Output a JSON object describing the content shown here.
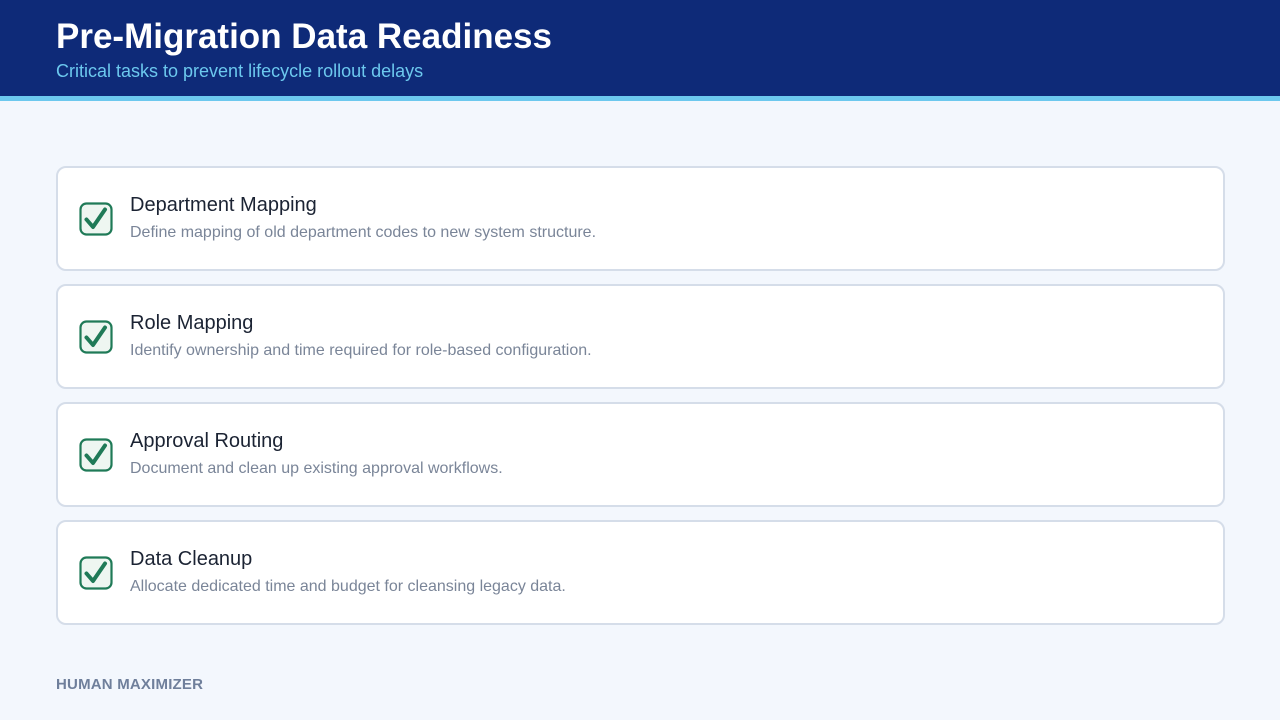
{
  "header": {
    "title": "Pre-Migration Data Readiness",
    "subtitle": "Critical tasks to prevent lifecycle rollout delays"
  },
  "colors": {
    "header_bg": "#0e2a78",
    "accent": "#6cc8ee",
    "check": "#1f7a57",
    "check_fill": "#eef6f1"
  },
  "tasks": [
    {
      "title": "Department Mapping",
      "description": "Define mapping of old department codes to new system structure.",
      "checked": true,
      "icon": "checkbox-checked-icon"
    },
    {
      "title": "Role Mapping",
      "description": "Identify ownership and time required for role-based configuration.",
      "checked": true,
      "icon": "checkbox-checked-icon"
    },
    {
      "title": "Approval Routing",
      "description": "Document and clean up existing approval workflows.",
      "checked": true,
      "icon": "checkbox-checked-icon"
    },
    {
      "title": "Data Cleanup",
      "description": "Allocate dedicated time and budget for cleansing legacy data.",
      "checked": true,
      "icon": "checkbox-checked-icon"
    }
  ],
  "footer": {
    "brand": "HUMAN MAXIMIZER"
  }
}
